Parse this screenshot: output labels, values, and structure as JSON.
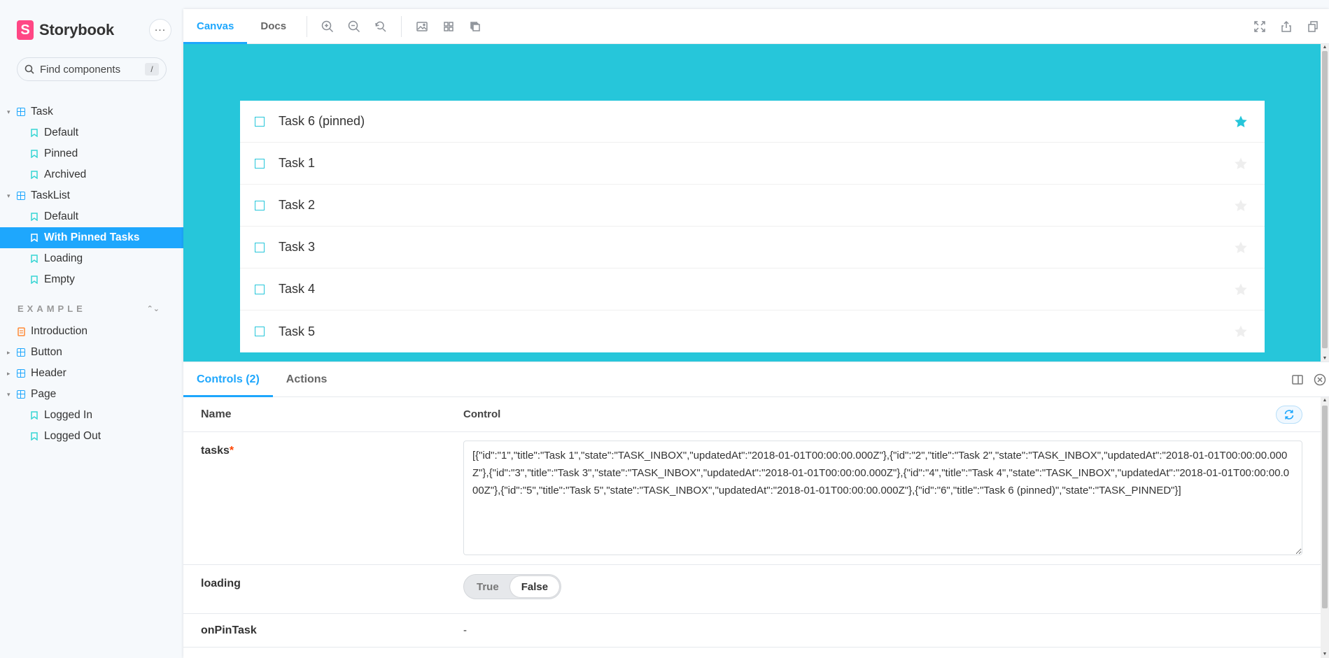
{
  "brand": {
    "name": "Storybook",
    "logo_letter": "S"
  },
  "search": {
    "placeholder": "Find components",
    "shortcut": "/"
  },
  "tree": {
    "task": {
      "label": "Task",
      "stories": [
        "Default",
        "Pinned",
        "Archived"
      ]
    },
    "tasklist": {
      "label": "TaskList",
      "stories": [
        "Default",
        "With Pinned Tasks",
        "Loading",
        "Empty"
      ],
      "selected": "With Pinned Tasks"
    },
    "section": "EXAMPLE",
    "introduction": "Introduction",
    "button": "Button",
    "header": "Header",
    "page": {
      "label": "Page",
      "stories": [
        "Logged In",
        "Logged Out"
      ]
    }
  },
  "toolbar": {
    "tabs": [
      "Canvas",
      "Docs"
    ],
    "active_tab": "Canvas"
  },
  "canvas": {
    "background": "#26c6da",
    "tasks": [
      {
        "title": "Task 6 (pinned)",
        "pinned": true
      },
      {
        "title": "Task 1",
        "pinned": false
      },
      {
        "title": "Task 2",
        "pinned": false
      },
      {
        "title": "Task 3",
        "pinned": false
      },
      {
        "title": "Task 4",
        "pinned": false
      },
      {
        "title": "Task 5",
        "pinned": false
      }
    ]
  },
  "addons": {
    "tabs": [
      "Controls (2)",
      "Actions"
    ],
    "active_tab": "Controls (2)",
    "header": {
      "name": "Name",
      "control": "Control"
    },
    "rows": {
      "tasks": {
        "name": "tasks",
        "required": "*",
        "value": "[{\"id\":\"1\",\"title\":\"Task 1\",\"state\":\"TASK_INBOX\",\"updatedAt\":\"2018-01-01T00:00:00.000Z\"},{\"id\":\"2\",\"title\":\"Task 2\",\"state\":\"TASK_INBOX\",\"updatedAt\":\"2018-01-01T00:00:00.000Z\"},{\"id\":\"3\",\"title\":\"Task 3\",\"state\":\"TASK_INBOX\",\"updatedAt\":\"2018-01-01T00:00:00.000Z\"},{\"id\":\"4\",\"title\":\"Task 4\",\"state\":\"TASK_INBOX\",\"updatedAt\":\"2018-01-01T00:00:00.000Z\"},{\"id\":\"5\",\"title\":\"Task 5\",\"state\":\"TASK_INBOX\",\"updatedAt\":\"2018-01-01T00:00:00.000Z\"},{\"id\":\"6\",\"title\":\"Task 6 (pinned)\",\"state\":\"TASK_PINNED\"}]"
      },
      "loading": {
        "name": "loading",
        "options": [
          "True",
          "False"
        ],
        "selected": "False"
      },
      "onPinTask": {
        "name": "onPinTask",
        "value": "-"
      }
    }
  },
  "colors": {
    "accent": "#1ea7fd",
    "brand": "#ff4785",
    "star": "#26c6da",
    "star_off": "#eeeeee"
  }
}
